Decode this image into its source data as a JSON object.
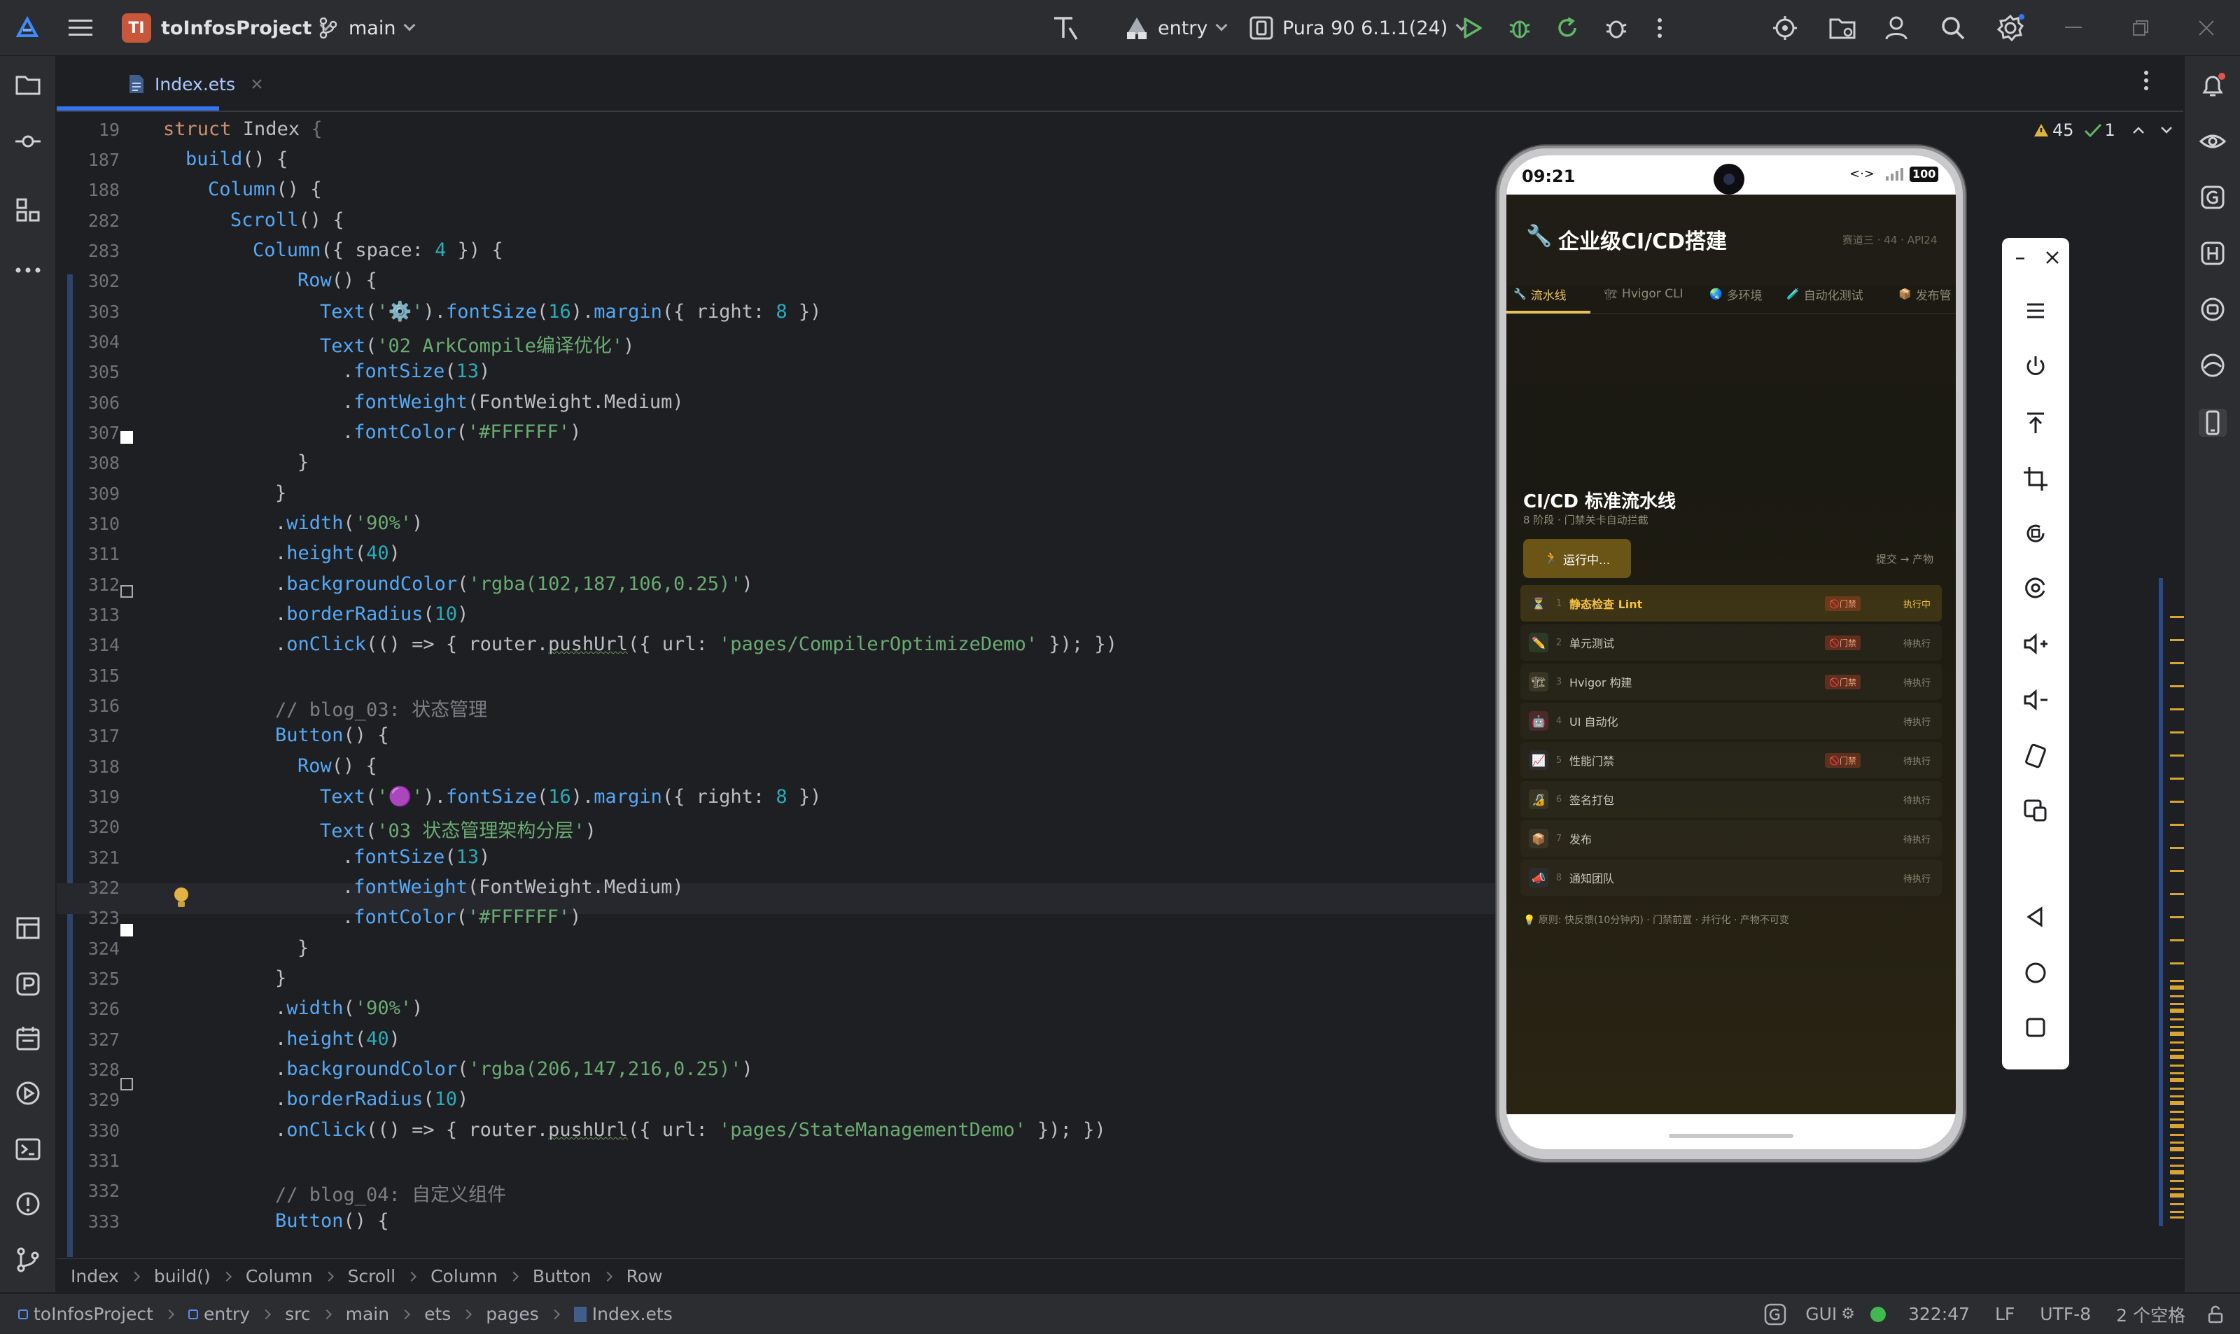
{
  "titlebar": {
    "project_initials": "TI",
    "project_name": "toInfosProject",
    "branch": "main",
    "run_config": "entry",
    "device": "Pura 90 6.1.1(24)",
    "window_controls": [
      "minimize",
      "restore",
      "close"
    ]
  },
  "left_rail": {
    "icons": [
      "folder-icon",
      "commit-icon",
      "structure-icon",
      "more-icon",
      "layers-icon",
      "profiler-icon",
      "calendar-icon",
      "run-icon",
      "terminal-icon",
      "problems-icon",
      "git-icon"
    ]
  },
  "right_rail": {
    "icons": [
      "notifications-icon",
      "preview-icon",
      "gradle-icon",
      "hvigor-icon",
      "device-manager-icon",
      "codegenie-icon",
      "device-icon"
    ]
  },
  "editor": {
    "tab_label": "Index.ets",
    "inspection": {
      "warnings": "45",
      "checks": "1"
    },
    "lines": [
      {
        "n": "19",
        "indent": 0,
        "code": [
          [
            "kw",
            "struct "
          ],
          [
            "ty",
            "Index "
          ],
          [
            "dim",
            "{"
          ]
        ]
      },
      {
        "n": "187",
        "indent": 1,
        "code": [
          [
            "fn",
            "build"
          ],
          [
            "ty",
            "() {"
          ]
        ]
      },
      {
        "n": "188",
        "indent": 2,
        "code": [
          [
            "fn",
            "Column"
          ],
          [
            "ty",
            "() {"
          ]
        ]
      },
      {
        "n": "282",
        "indent": 3,
        "code": [
          [
            "fn",
            "Scroll"
          ],
          [
            "ty",
            "() {"
          ]
        ]
      },
      {
        "n": "283",
        "indent": 4,
        "code": [
          [
            "fn",
            "Column"
          ],
          [
            "ty",
            "({ space: "
          ],
          [
            "num",
            "4"
          ],
          [
            "ty",
            " }) {"
          ]
        ]
      },
      {
        "n": "302",
        "indent": 6,
        "code": [
          [
            "fn",
            "Row"
          ],
          [
            "ty",
            "() {"
          ]
        ]
      },
      {
        "n": "303",
        "indent": 7,
        "code": [
          [
            "fn",
            "Text"
          ],
          [
            "ty",
            "("
          ],
          [
            "str",
            "'⚙️'"
          ],
          [
            "ty",
            ")."
          ],
          [
            "fn",
            "fontSize"
          ],
          [
            "ty",
            "("
          ],
          [
            "num",
            "16"
          ],
          [
            "ty",
            ")."
          ],
          [
            "fn",
            "margin"
          ],
          [
            "ty",
            "({ right: "
          ],
          [
            "num",
            "8"
          ],
          [
            "ty",
            " })"
          ]
        ]
      },
      {
        "n": "304",
        "indent": 7,
        "code": [
          [
            "fn",
            "Text"
          ],
          [
            "ty",
            "("
          ],
          [
            "str",
            "'02 ArkCompile编译优化'"
          ],
          [
            "ty",
            ")"
          ]
        ]
      },
      {
        "n": "305",
        "indent": 8,
        "code": [
          [
            "ty",
            "."
          ],
          [
            "fn",
            "fontSize"
          ],
          [
            "ty",
            "("
          ],
          [
            "num",
            "13"
          ],
          [
            "ty",
            ")"
          ]
        ]
      },
      {
        "n": "306",
        "indent": 8,
        "code": [
          [
            "ty",
            "."
          ],
          [
            "fn",
            "fontWeight"
          ],
          [
            "ty",
            "(FontWeight.Medium)"
          ]
        ]
      },
      {
        "n": "307",
        "indent": 8,
        "code": [
          [
            "ty",
            "."
          ],
          [
            "fn",
            "fontColor"
          ],
          [
            "ty",
            "("
          ],
          [
            "str",
            "'#FFFFFF'"
          ],
          [
            "ty",
            ")"
          ]
        ]
      },
      {
        "n": "308",
        "indent": 6,
        "code": [
          [
            "ty",
            "}"
          ]
        ]
      },
      {
        "n": "309",
        "indent": 5,
        "code": [
          [
            "ty",
            "}"
          ]
        ]
      },
      {
        "n": "310",
        "indent": 5,
        "code": [
          [
            "ty",
            "."
          ],
          [
            "fn",
            "width"
          ],
          [
            "ty",
            "("
          ],
          [
            "str",
            "'90%'"
          ],
          [
            "ty",
            ")"
          ]
        ]
      },
      {
        "n": "311",
        "indent": 5,
        "code": [
          [
            "ty",
            "."
          ],
          [
            "fn",
            "height"
          ],
          [
            "ty",
            "("
          ],
          [
            "num",
            "40"
          ],
          [
            "ty",
            ")"
          ]
        ]
      },
      {
        "n": "312",
        "indent": 5,
        "code": [
          [
            "ty",
            "."
          ],
          [
            "fn",
            "backgroundColor"
          ],
          [
            "ty",
            "("
          ],
          [
            "str",
            "'rgba(102,187,106,0.25)'"
          ],
          [
            "ty",
            ")"
          ]
        ]
      },
      {
        "n": "313",
        "indent": 5,
        "code": [
          [
            "ty",
            "."
          ],
          [
            "fn",
            "borderRadius"
          ],
          [
            "ty",
            "("
          ],
          [
            "num",
            "10"
          ],
          [
            "ty",
            ")"
          ]
        ]
      },
      {
        "n": "314",
        "indent": 5,
        "code": [
          [
            "ty",
            "."
          ],
          [
            "fn",
            "onClick"
          ],
          [
            "ty",
            "(() => { router."
          ],
          [
            "und",
            "pushUrl"
          ],
          [
            "ty",
            "({ url: "
          ],
          [
            "str",
            "'pages/CompilerOptimizeDemo'"
          ],
          [
            "ty",
            " }); })"
          ]
        ]
      },
      {
        "n": "315",
        "indent": 0,
        "code": []
      },
      {
        "n": "316",
        "indent": 5,
        "code": [
          [
            "cm",
            "// blog_03: 状态管理"
          ]
        ]
      },
      {
        "n": "317",
        "indent": 5,
        "code": [
          [
            "fn",
            "Button"
          ],
          [
            "ty",
            "() {"
          ]
        ]
      },
      {
        "n": "318",
        "indent": 6,
        "code": [
          [
            "fn",
            "Row"
          ],
          [
            "ty",
            "() {"
          ]
        ]
      },
      {
        "n": "319",
        "indent": 7,
        "code": [
          [
            "fn",
            "Text"
          ],
          [
            "ty",
            "("
          ],
          [
            "str",
            "'🟣'"
          ],
          [
            "ty",
            ")."
          ],
          [
            "fn",
            "fontSize"
          ],
          [
            "ty",
            "("
          ],
          [
            "num",
            "16"
          ],
          [
            "ty",
            ")."
          ],
          [
            "fn",
            "margin"
          ],
          [
            "ty",
            "({ right: "
          ],
          [
            "num",
            "8"
          ],
          [
            "ty",
            " })"
          ]
        ]
      },
      {
        "n": "320",
        "indent": 7,
        "code": [
          [
            "fn",
            "Text"
          ],
          [
            "ty",
            "("
          ],
          [
            "str",
            "'03 状态管理架构分层'"
          ],
          [
            "ty",
            ")"
          ]
        ]
      },
      {
        "n": "321",
        "indent": 8,
        "code": [
          [
            "ty",
            "."
          ],
          [
            "fn",
            "fontSize"
          ],
          [
            "ty",
            "("
          ],
          [
            "num",
            "13"
          ],
          [
            "ty",
            ")"
          ]
        ]
      },
      {
        "n": "322",
        "indent": 8,
        "code": [
          [
            "ty",
            "."
          ],
          [
            "fn",
            "fontWeight"
          ],
          [
            "ty",
            "(FontWeight.Medium)"
          ]
        ]
      },
      {
        "n": "323",
        "indent": 8,
        "code": [
          [
            "ty",
            "."
          ],
          [
            "fn",
            "fontColor"
          ],
          [
            "ty",
            "("
          ],
          [
            "str",
            "'#FFFFFF'"
          ],
          [
            "ty",
            ")"
          ]
        ]
      },
      {
        "n": "324",
        "indent": 6,
        "code": [
          [
            "ty",
            "}"
          ]
        ]
      },
      {
        "n": "325",
        "indent": 5,
        "code": [
          [
            "ty",
            "}"
          ]
        ]
      },
      {
        "n": "326",
        "indent": 5,
        "code": [
          [
            "ty",
            "."
          ],
          [
            "fn",
            "width"
          ],
          [
            "ty",
            "("
          ],
          [
            "str",
            "'90%'"
          ],
          [
            "ty",
            ")"
          ]
        ]
      },
      {
        "n": "327",
        "indent": 5,
        "code": [
          [
            "ty",
            "."
          ],
          [
            "fn",
            "height"
          ],
          [
            "ty",
            "("
          ],
          [
            "num",
            "40"
          ],
          [
            "ty",
            ")"
          ]
        ]
      },
      {
        "n": "328",
        "indent": 5,
        "code": [
          [
            "ty",
            "."
          ],
          [
            "fn",
            "backgroundColor"
          ],
          [
            "ty",
            "("
          ],
          [
            "str",
            "'rgba(206,147,216,0.25)'"
          ],
          [
            "ty",
            ")"
          ]
        ]
      },
      {
        "n": "329",
        "indent": 5,
        "code": [
          [
            "ty",
            "."
          ],
          [
            "fn",
            "borderRadius"
          ],
          [
            "ty",
            "("
          ],
          [
            "num",
            "10"
          ],
          [
            "ty",
            ")"
          ]
        ]
      },
      {
        "n": "330",
        "indent": 5,
        "code": [
          [
            "ty",
            "."
          ],
          [
            "fn",
            "onClick"
          ],
          [
            "ty",
            "(() => { router."
          ],
          [
            "und",
            "pushUrl"
          ],
          [
            "ty",
            "({ url: "
          ],
          [
            "str",
            "'pages/StateManagementDemo'"
          ],
          [
            "ty",
            " }); })"
          ]
        ]
      },
      {
        "n": "331",
        "indent": 0,
        "code": []
      },
      {
        "n": "332",
        "indent": 5,
        "code": [
          [
            "cm",
            "// blog_04: 自定义组件"
          ]
        ]
      },
      {
        "n": "333",
        "indent": 5,
        "code": [
          [
            "fn",
            "Button"
          ],
          [
            "ty",
            "() {"
          ]
        ]
      }
    ]
  },
  "breadcrumbs": [
    "Index",
    "build()",
    "Column",
    "Scroll",
    "Column",
    "Button",
    "Row"
  ],
  "statusbar": {
    "path": [
      "toInfosProject",
      "entry",
      "src",
      "main",
      "ets",
      "pages",
      "Index.ets"
    ],
    "gui": "GUI",
    "position": "322:47",
    "line_sep": "LF",
    "encoding": "UTF-8",
    "indent": "2 个空格"
  },
  "phone": {
    "time": "09:21",
    "battery": "100",
    "app_title": "企业级CI/CD搭建",
    "app_meta": "赛道三 · 44 · API24",
    "tabs": [
      {
        "icon": "🔧",
        "label": "流水线",
        "active": true
      },
      {
        "icon": "🏗",
        "label": "Hvigor CLI",
        "active": false
      },
      {
        "icon": "🌏",
        "label": "多环境",
        "active": false
      },
      {
        "icon": "🧪",
        "label": "自动化测试",
        "active": false
      },
      {
        "icon": "📦",
        "label": "发布管",
        "active": false
      }
    ],
    "section_title": "CI/CD 标准流水线",
    "section_sub": "8 阶段 · 门禁关卡自动拦截",
    "run_button": "运行中...",
    "flow_label": "提交 → 产物",
    "stages": [
      {
        "icon": "⏳",
        "n": "1",
        "name": "静态检查 Lint",
        "gate": "🚫门禁",
        "status": "执行中",
        "active": true
      },
      {
        "icon": "✏️",
        "n": "2",
        "name": "单元测试",
        "gate": "🚫门禁",
        "status": "待执行",
        "active": false
      },
      {
        "icon": "🏗",
        "n": "3",
        "name": "Hvigor 构建",
        "gate": "🚫门禁",
        "status": "待执行",
        "active": false
      },
      {
        "icon": "🤖",
        "n": "4",
        "name": "UI 自动化",
        "gate": "",
        "status": "待执行",
        "active": false
      },
      {
        "icon": "📈",
        "n": "5",
        "name": "性能门禁",
        "gate": "🚫门禁",
        "status": "待执行",
        "active": false
      },
      {
        "icon": "🔏",
        "n": "6",
        "name": "签名打包",
        "gate": "",
        "status": "待执行",
        "active": false
      },
      {
        "icon": "📦",
        "n": "7",
        "name": "发布",
        "gate": "",
        "status": "待执行",
        "active": false
      },
      {
        "icon": "📣",
        "n": "8",
        "name": "通知团队",
        "gate": "",
        "status": "待执行",
        "active": false
      }
    ],
    "principle": "💡 原则: 快反馈(10分钟内) · 门禁前置 · 并行化 · 产物不可变"
  },
  "colors": {
    "accent": "#3574f0",
    "stage_active": "#f5c242",
    "warning": "#d8a533"
  }
}
